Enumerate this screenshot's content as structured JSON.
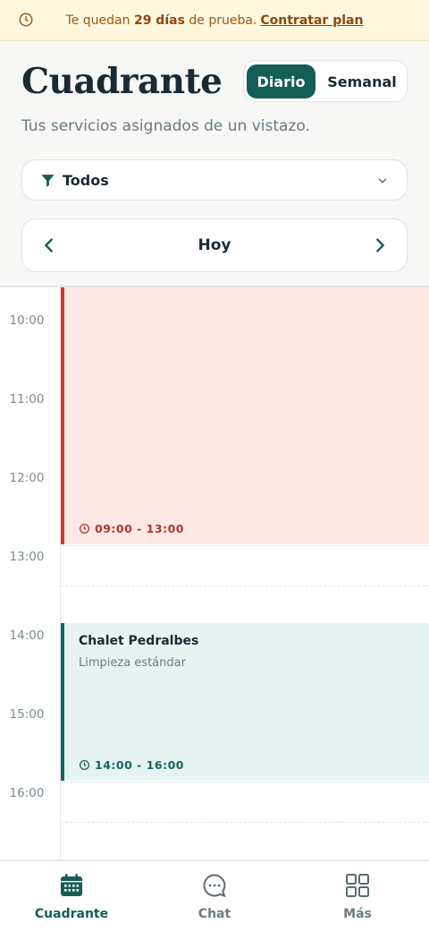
{
  "banner": {
    "prefix": "Te quedan",
    "days": "29 días",
    "suffix": "de prueba.",
    "link": "Contratar plan"
  },
  "header": {
    "title": "Cuadrante",
    "toggle": {
      "daily": "Diario",
      "weekly": "Semanal",
      "selected": "Diario"
    },
    "subtitle": "Tus servicios asignados de un vistazo.",
    "filter": {
      "label": "Todos"
    },
    "day_nav": {
      "label": "Hoy"
    }
  },
  "timeline": {
    "hours": [
      "10:00",
      "11:00",
      "12:00",
      "13:00",
      "14:00",
      "15:00",
      "16:00"
    ],
    "events": [
      {
        "name": "",
        "type": "",
        "time": "09:00 - 13:00",
        "color": "#cf3a2e"
      },
      {
        "name": "Chalet Pedralbes",
        "type": "Limpieza estándar",
        "time": "14:00 - 16:00",
        "color": "#16665d"
      }
    ]
  },
  "bottom_nav": {
    "items": [
      {
        "label": "Cuadrante",
        "icon": "calendar-icon",
        "active": true
      },
      {
        "label": "Chat",
        "icon": "chat-icon",
        "active": false
      },
      {
        "label": "Más",
        "icon": "grid-icon",
        "active": false
      }
    ]
  },
  "colors": {
    "brand": "#145e56",
    "banner_bg": "#fdf7dd",
    "banner_text": "#9a5a19",
    "event_red": "#cf3a2e",
    "event_green": "#16665d"
  }
}
